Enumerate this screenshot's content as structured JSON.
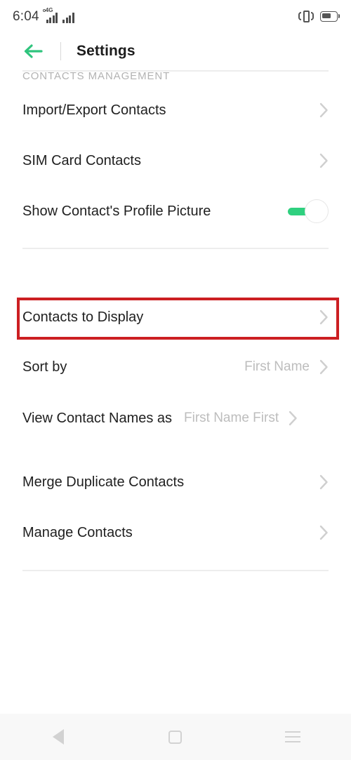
{
  "status_bar": {
    "time": "6:04",
    "network_type": "4G",
    "signal_icon_1": "signal-bars-icon",
    "signal_icon_2": "signal-bars-icon",
    "vibrate_icon": "vibrate-mode-icon",
    "battery_icon": "battery-icon"
  },
  "header": {
    "back_icon": "back-arrow-icon",
    "title": "Settings"
  },
  "settings": {
    "top_items": [
      {
        "label": "Import/Export Contacts",
        "chevron": "chevron-right-icon"
      },
      {
        "label": "SIM Card Contacts",
        "chevron": "chevron-right-icon"
      },
      {
        "label": "Show Contact's Profile Picture",
        "control": "toggle",
        "value": "on"
      }
    ],
    "section_title": "CONTACTS MANAGEMENT",
    "section_items": [
      {
        "label": "Contacts to Display",
        "value": "",
        "chevron": "chevron-right-icon",
        "highlighted": true
      },
      {
        "label": "Sort by",
        "value": "First Name",
        "chevron": "chevron-right-icon"
      },
      {
        "label": "View Contact Names as",
        "value": "First Name First",
        "chevron": "chevron-right-icon"
      },
      {
        "label": "Merge Duplicate Contacts",
        "value": "",
        "chevron": "chevron-right-icon"
      },
      {
        "label": "Manage Contacts",
        "value": "",
        "chevron": "chevron-right-icon"
      }
    ]
  },
  "nav_bar": {
    "back": "nav-back-icon",
    "home": "nav-home-icon",
    "recents": "nav-recents-icon"
  },
  "colors": {
    "accent_green": "#2fd07f",
    "highlight_red": "#cc1f22",
    "value_gray": "#bdbdbd",
    "section_gray": "#b3b3b3"
  }
}
